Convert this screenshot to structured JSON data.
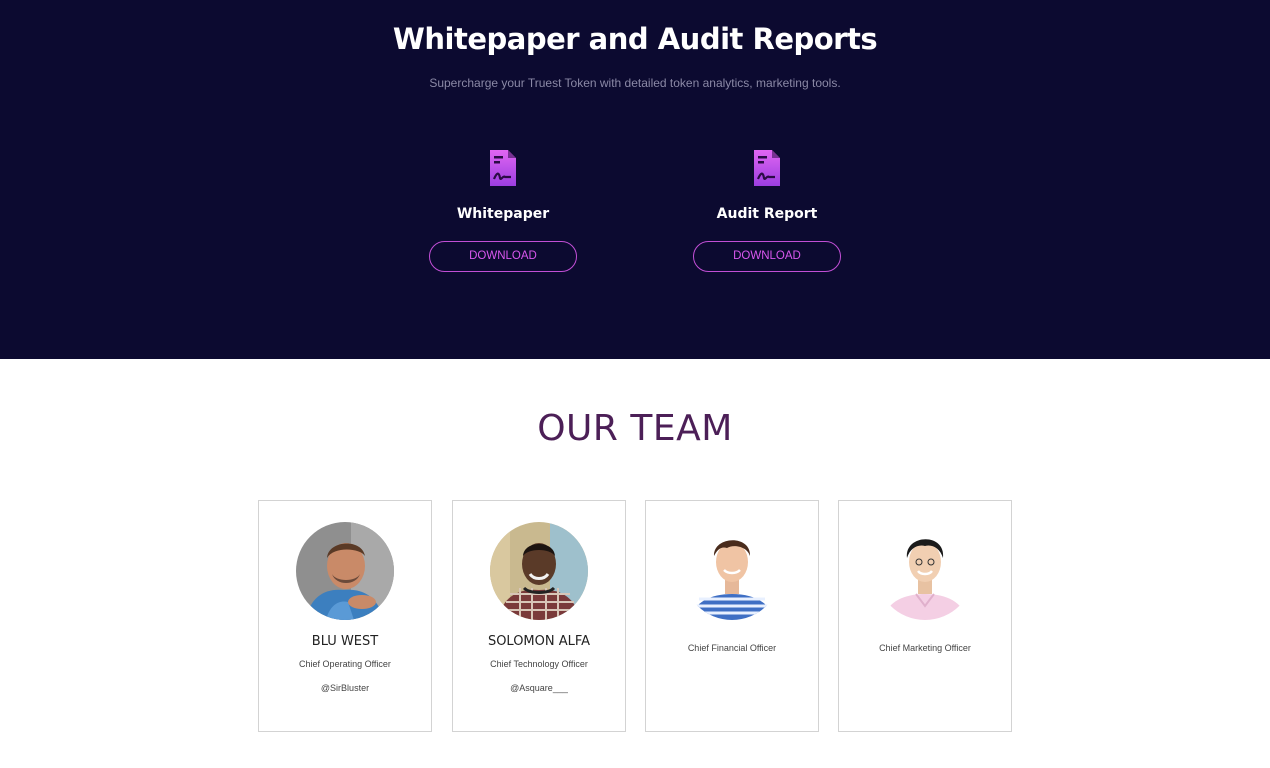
{
  "hero": {
    "title": "Whitepaper and Audit Reports",
    "subtitle": "Supercharge your Truest Token with detailed token analytics, marketing tools.",
    "background": "#0c0a30",
    "documents": [
      {
        "label": "Whitepaper",
        "button": "DOWNLOAD",
        "icon": "document-signature-icon"
      },
      {
        "label": "Audit Report",
        "button": "DOWNLOAD",
        "icon": "document-signature-icon"
      }
    ]
  },
  "team": {
    "title": "OUR TEAM",
    "members": [
      {
        "name": "BLU WEST",
        "role": "Chief Operating Officer",
        "handle": "@SirBluster"
      },
      {
        "name": "SOLOMON ALFA",
        "role": "Chief Technology Officer",
        "handle": "@Asquare___"
      },
      {
        "name": "",
        "role": "Chief Financial Officer",
        "handle": ""
      },
      {
        "name": "",
        "role": "Chief Marketing Officer",
        "handle": ""
      }
    ]
  },
  "colors": {
    "accent": "#d957ee",
    "team_title": "#4c1f57"
  }
}
